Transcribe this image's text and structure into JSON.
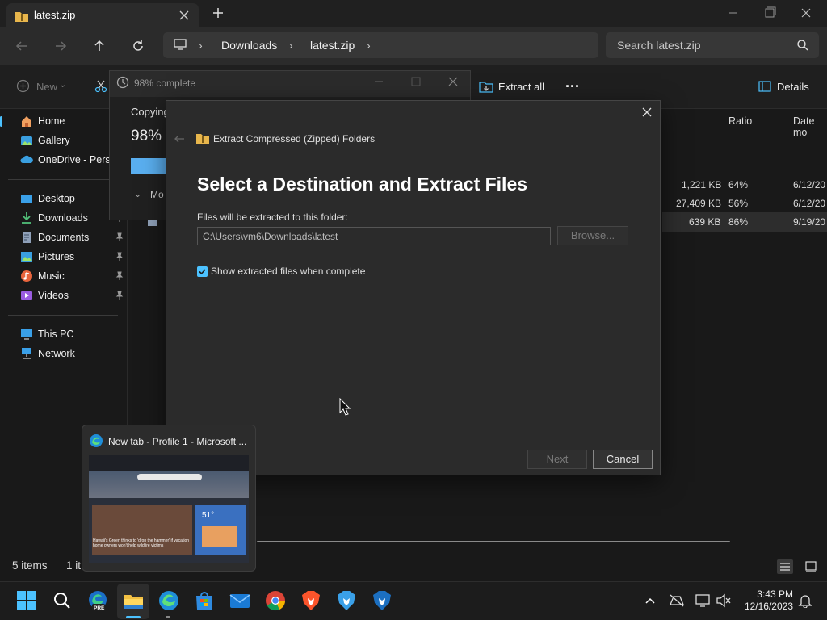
{
  "explorer": {
    "tab_title": "latest.zip",
    "breadcrumb": [
      "Downloads",
      "latest.zip"
    ],
    "search_placeholder": "Search latest.zip",
    "toolbar": {
      "new_label": "New",
      "extract_all_label": "Extract all",
      "more_label": "...",
      "details_label": "Details"
    },
    "sidebar": [
      {
        "label": "Home",
        "icon": "home-icon",
        "pinned": false
      },
      {
        "label": "Gallery",
        "icon": "gallery-icon",
        "pinned": false
      },
      {
        "label": "OneDrive - Perso",
        "icon": "onedrive-icon",
        "pinned": false
      },
      {
        "label": "Desktop",
        "icon": "desktop-icon",
        "pinned": true
      },
      {
        "label": "Downloads",
        "icon": "downloads-icon",
        "pinned": true
      },
      {
        "label": "Documents",
        "icon": "documents-icon",
        "pinned": true
      },
      {
        "label": "Pictures",
        "icon": "pictures-icon",
        "pinned": true
      },
      {
        "label": "Music",
        "icon": "music-icon",
        "pinned": true
      },
      {
        "label": "Videos",
        "icon": "videos-icon",
        "pinned": true
      },
      {
        "label": "This PC",
        "icon": "pc-icon",
        "pinned": false
      },
      {
        "label": "Network",
        "icon": "network-icon",
        "pinned": false
      }
    ],
    "columns": {
      "ratio": "Ratio",
      "date": "Date mo"
    },
    "rows": [
      {
        "size": "1,221 KB",
        "ratio": "64%",
        "date": "6/12/20"
      },
      {
        "size": "27,409 KB",
        "ratio": "56%",
        "date": "6/12/20"
      },
      {
        "size": "639 KB",
        "ratio": "86%",
        "date": "9/19/20"
      }
    ],
    "status": {
      "items": "5 items",
      "selected": "1 it"
    }
  },
  "progress_dialog": {
    "title": "98% complete",
    "copying": "Copying",
    "percent_text": "98%",
    "percent": 98,
    "more_label": "Mo"
  },
  "wizard": {
    "header": "Extract Compressed (Zipped) Folders",
    "heading": "Select a Destination and Extract Files",
    "dest_label": "Files will be extracted to this folder:",
    "dest_path": "C:\\Users\\vm6\\Downloads\\latest",
    "browse_label": "Browse...",
    "checkbox_label": "Show extracted files when complete",
    "checkbox_checked": true,
    "next_label": "Next",
    "cancel_label": "Cancel"
  },
  "thumbnail": {
    "title": "New tab - Profile 1 - Microsoft ...",
    "news_headline": "Hawaii's Green thinks to 'drop the hammer' if vacation home owners won't help wildfire victims",
    "weather_temp": "51°"
  },
  "taskbar": {
    "apps": [
      "start-icon",
      "search-icon",
      "edge-dev-icon",
      "file-explorer-icon",
      "edge-icon",
      "store-icon",
      "mail-icon",
      "chrome-icon",
      "brave-icon",
      "brave-beta-icon",
      "brave-nightly-icon"
    ],
    "time": "3:43 PM",
    "date": "12/16/2023"
  },
  "colors": {
    "accent": "#4cc2ff",
    "dark_bg": "#1c1c1c",
    "panel": "#2b2b2b"
  }
}
